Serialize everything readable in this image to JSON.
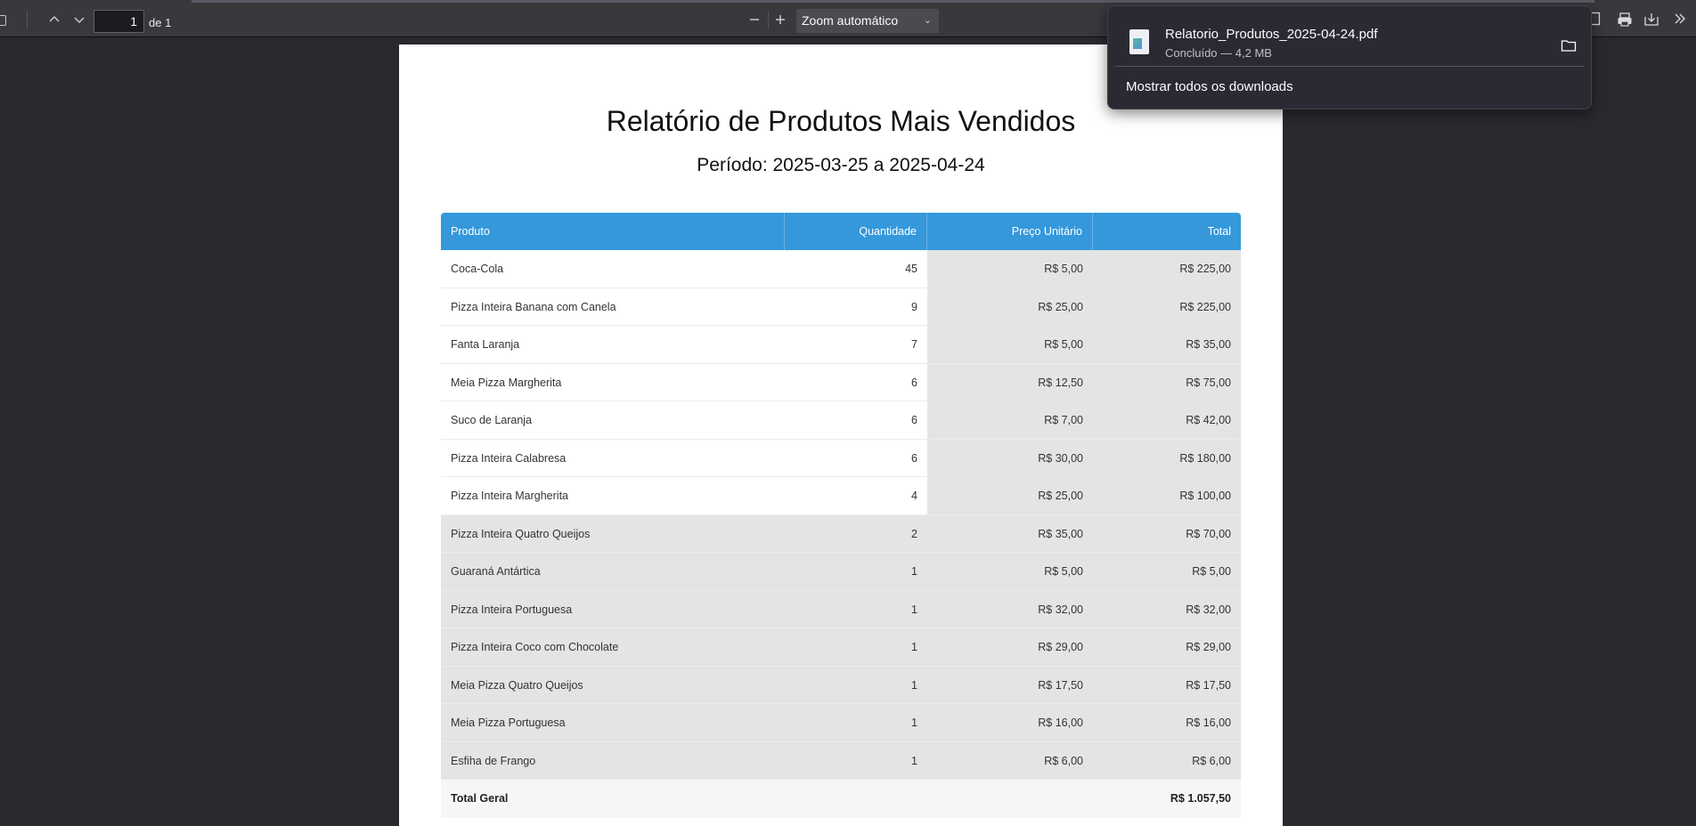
{
  "toolbar": {
    "page_number": "1",
    "page_of": "de 1",
    "zoom_label": "Zoom automático"
  },
  "document": {
    "title": "Relatório de Produtos Mais Vendidos",
    "period": "Período: 2025-03-25 a 2025-04-24",
    "columns": [
      "Produto",
      "Quantidade",
      "Preço Unitário",
      "Total"
    ],
    "rows": [
      {
        "produto": "Coca-Cola",
        "quantidade": "45",
        "preco": "R$ 5,00",
        "total": "R$ 225,00"
      },
      {
        "produto": "Pizza Inteira Banana com Canela",
        "quantidade": "9",
        "preco": "R$ 25,00",
        "total": "R$ 225,00"
      },
      {
        "produto": "Fanta Laranja",
        "quantidade": "7",
        "preco": "R$ 5,00",
        "total": "R$ 35,00"
      },
      {
        "produto": "Meia Pizza Margherita",
        "quantidade": "6",
        "preco": "R$ 12,50",
        "total": "R$ 75,00"
      },
      {
        "produto": "Suco de Laranja",
        "quantidade": "6",
        "preco": "R$ 7,00",
        "total": "R$ 42,00"
      },
      {
        "produto": "Pizza Inteira Calabresa",
        "quantidade": "6",
        "preco": "R$ 30,00",
        "total": "R$ 180,00"
      },
      {
        "produto": "Pizza Inteira Margherita",
        "quantidade": "4",
        "preco": "R$ 25,00",
        "total": "R$ 100,00"
      },
      {
        "produto": "Pizza Inteira Quatro Queijos",
        "quantidade": "2",
        "preco": "R$ 35,00",
        "total": "R$ 70,00"
      },
      {
        "produto": "Guaraná Antártica",
        "quantidade": "1",
        "preco": "R$ 5,00",
        "total": "R$ 5,00"
      },
      {
        "produto": "Pizza Inteira Portuguesa",
        "quantidade": "1",
        "preco": "R$ 32,00",
        "total": "R$ 32,00"
      },
      {
        "produto": "Pizza Inteira Coco com Chocolate",
        "quantidade": "1",
        "preco": "R$ 29,00",
        "total": "R$ 29,00"
      },
      {
        "produto": "Meia Pizza Quatro Queijos",
        "quantidade": "1",
        "preco": "R$ 17,50",
        "total": "R$ 17,50"
      },
      {
        "produto": "Meia Pizza Portuguesa",
        "quantidade": "1",
        "preco": "R$ 16,00",
        "total": "R$ 16,00"
      },
      {
        "produto": "Esfiha de Frango",
        "quantidade": "1",
        "preco": "R$ 6,00",
        "total": "R$ 6,00"
      }
    ],
    "total_label": "Total Geral",
    "total_value": "R$ 1.057,50"
  },
  "downloads": {
    "file_name": "Relatorio_Produtos_2025-04-24.pdf",
    "status": "Concluído — 4,2 MB",
    "show_all": "Mostrar todos os downloads"
  },
  "colors": {
    "table_header": "#3498db",
    "viewer_bg": "#2a2a2e",
    "toolbar_bg": "#38383d",
    "panel_bg": "#2b2a33"
  }
}
